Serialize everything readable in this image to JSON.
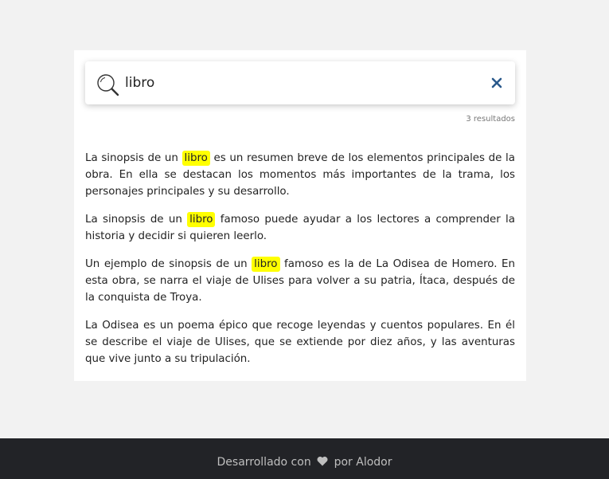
{
  "search": {
    "value": "libro",
    "placeholder": "",
    "icon": "search-icon",
    "clear_icon": "close-icon"
  },
  "result_count": "3 resultados",
  "highlight_color": "#ffff00",
  "results": [
    {
      "before": "La sinopsis de un ",
      "match": "libro",
      "after": " es un resumen breve de los elementos principales de la obra. En ella se destacan los momentos más importantes de la trama, los personajes principales y su desarrollo."
    },
    {
      "before": "La sinopsis de un ",
      "match": "libro",
      "after": " famoso puede ayudar a los lectores a comprender la historia y decidir si quieren leerlo."
    },
    {
      "before": "Un ejemplo de sinopsis de un ",
      "match": "libro",
      "after": " famoso es la de La Odisea de Homero. En esta obra, se narra el viaje de Ulises para volver a su patria, Ítaca, después de la conquista de Troya."
    },
    {
      "text": "La Odisea es un poema épico que recoge leyendas y cuentos populares. En él se describe el viaje de Ulises, que se extiende por diez años, y las aventuras que vive junto a su tripulación."
    }
  ],
  "footer": {
    "prefix": "Desarrollado con",
    "icon": "heart-icon",
    "suffix": "por Alodor",
    "background": "#222327"
  }
}
